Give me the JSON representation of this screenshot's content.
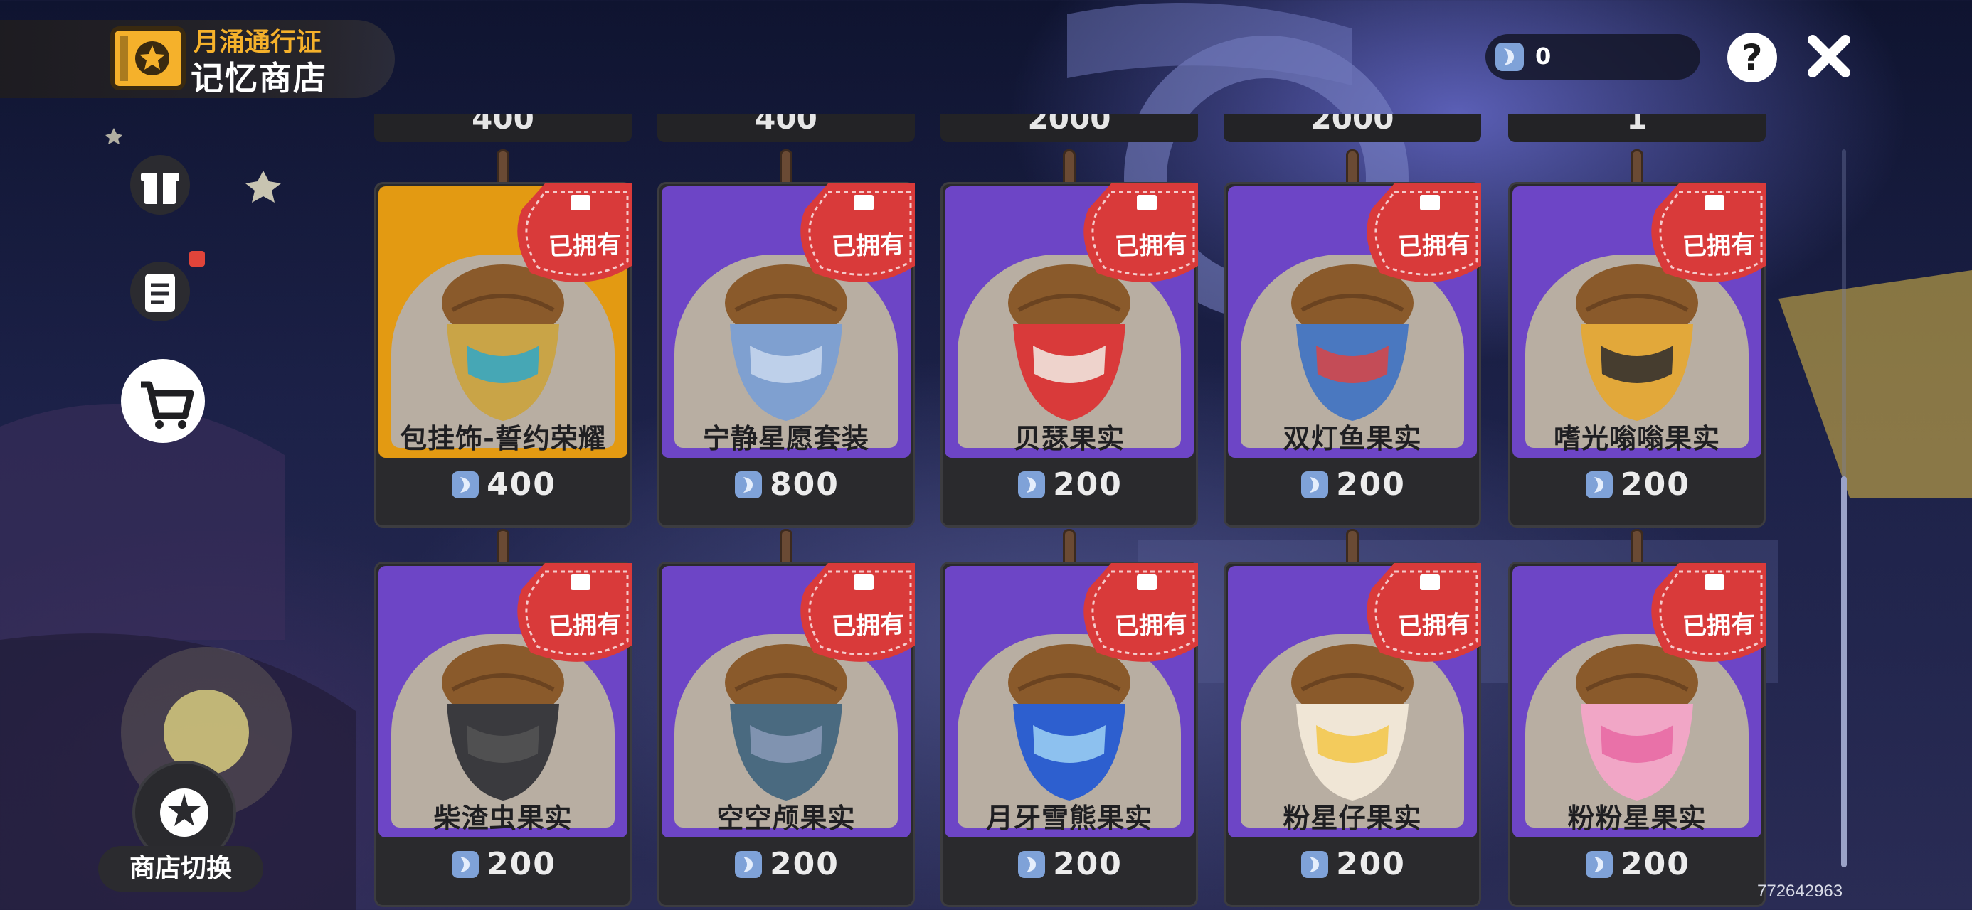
{
  "header": {
    "subtitle": "月涌通行证",
    "title": "记忆商店",
    "currency_icon": "moon-token-icon",
    "currency_value": "0",
    "help_label": "?"
  },
  "sidebar": {
    "items": [
      {
        "icon": "gift-icon"
      },
      {
        "icon": "task-list-icon"
      },
      {
        "icon": "shop-cart-icon"
      }
    ],
    "switch_label": "商店切换"
  },
  "partial_row": {
    "prices": [
      "400",
      "400",
      "2000",
      "2000",
      "1"
    ]
  },
  "owned_label": "已拥有",
  "row1": [
    {
      "name": "包挂饰-誓约荣耀",
      "price": "400",
      "card_color": "gold"
    },
    {
      "name": "宁静星愿套装",
      "price": "800",
      "card_color": "purple"
    },
    {
      "name": "贝瑟果实",
      "price": "200",
      "card_color": "purple"
    },
    {
      "name": "双灯鱼果实",
      "price": "200",
      "card_color": "purple"
    },
    {
      "name": "嗜光嗡嗡果实",
      "price": "200",
      "card_color": "purple"
    }
  ],
  "row2": [
    {
      "name": "柴渣虫果实",
      "price": "200",
      "card_color": "purple"
    },
    {
      "name": "空空颅果实",
      "price": "200",
      "card_color": "purple"
    },
    {
      "name": "月牙雪熊果实",
      "price": "200",
      "card_color": "purple"
    },
    {
      "name": "粉星仔果实",
      "price": "200",
      "card_color": "purple"
    },
    {
      "name": "粉粉星果实",
      "price": "200",
      "card_color": "purple"
    }
  ],
  "colors": {
    "accent_gold": "#f5b12b",
    "card_purple": "#6d45c6",
    "card_gold": "#e39a12",
    "owned_badge": "#d93a3a"
  },
  "watermark": "772642963"
}
